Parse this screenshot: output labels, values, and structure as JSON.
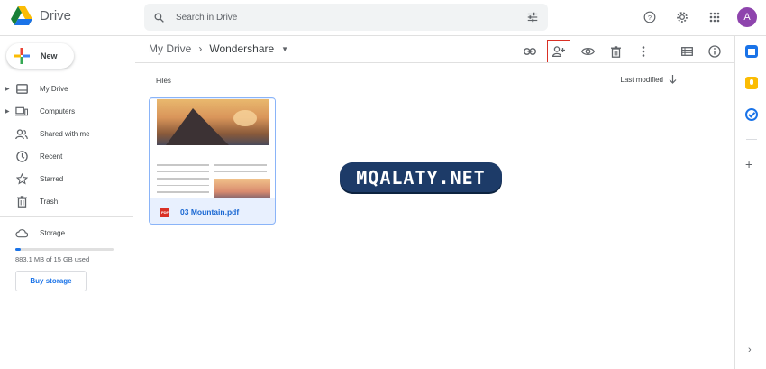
{
  "app": {
    "title": "Drive",
    "avatar_letter": "A",
    "brand_colors": {
      "blue": "#1a73e8",
      "red": "#d93025",
      "yellow": "#fbbc04",
      "green": "#188038"
    }
  },
  "search": {
    "placeholder": "Search in Drive"
  },
  "header_icons": [
    "help-icon",
    "settings-icon",
    "apps-grid-icon"
  ],
  "sidebar": {
    "new_label": "New",
    "items": [
      {
        "label": "My Drive",
        "icon": "drive-icon",
        "expandable": true
      },
      {
        "label": "Computers",
        "icon": "computer-icon",
        "expandable": true
      },
      {
        "label": "Shared with me",
        "icon": "people-icon",
        "expandable": false
      },
      {
        "label": "Recent",
        "icon": "clock-icon",
        "expandable": false
      },
      {
        "label": "Starred",
        "icon": "star-icon",
        "expandable": false
      },
      {
        "label": "Trash",
        "icon": "trash-icon",
        "expandable": false
      }
    ],
    "storage": {
      "label": "Storage",
      "used_text": "883.1 MB of 15 GB used",
      "used_fraction": 0.059,
      "buy_label": "Buy storage"
    }
  },
  "breadcrumb": {
    "root": "My Drive",
    "current": "Wondershare"
  },
  "toolbar": {
    "actions": [
      "link-icon",
      "add-person-icon",
      "preview-icon",
      "delete-icon",
      "more-icon",
      "list-view-icon",
      "info-icon"
    ],
    "highlighted": "add-person-icon"
  },
  "files": {
    "section_label": "Files",
    "sort_label": "Last modified",
    "items": [
      {
        "name": "03 Mountain.pdf",
        "type": "PDF",
        "selected": true
      }
    ]
  },
  "watermark": {
    "text": "MQALATY.NET"
  }
}
